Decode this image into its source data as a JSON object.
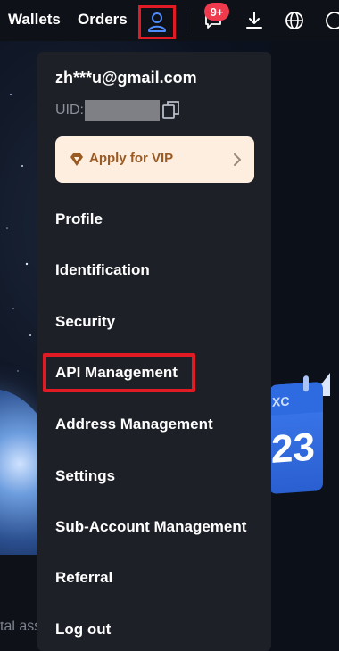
{
  "nav": {
    "wallets": "Wallets",
    "orders": "Orders",
    "user_icon": "user-icon",
    "message_icon": "chat-bubble-icon",
    "message_badge": "9+",
    "download_icon": "download-icon",
    "language_icon": "globe-icon"
  },
  "account_menu": {
    "email": "zh***u@gmail.com",
    "uid_label": "UID:",
    "copy_icon": "copy-icon",
    "vip": {
      "icon": "diamond-icon",
      "label": "Apply for VIP"
    },
    "items": [
      {
        "label": "Profile"
      },
      {
        "label": "Identification"
      },
      {
        "label": "Security"
      },
      {
        "label": "API Management"
      },
      {
        "label": "Address Management"
      },
      {
        "label": "Settings"
      },
      {
        "label": "Sub-Account Management"
      },
      {
        "label": "Referral"
      },
      {
        "label": "Log out"
      }
    ]
  },
  "background": {
    "partial_text": "tal ass",
    "calendar_text": "XC",
    "calendar_number": "23"
  },
  "colors": {
    "highlight": "#e01b24",
    "vip_bg": "#fdeee0",
    "vip_text": "#9a5a23",
    "badge": "#ef3a4d",
    "menu_bg": "#1e2027"
  }
}
